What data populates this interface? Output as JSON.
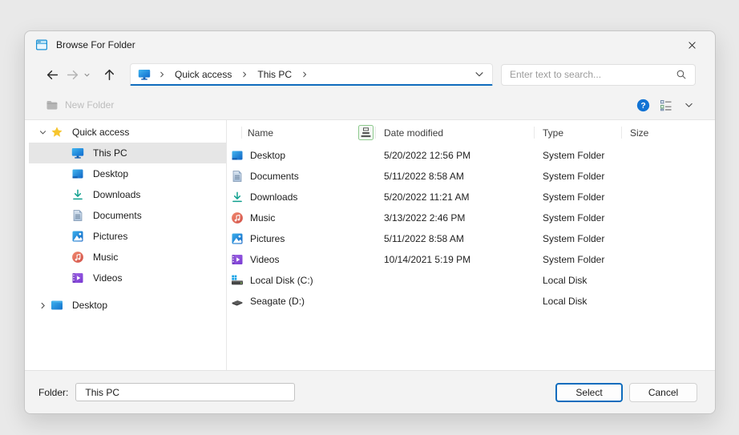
{
  "window": {
    "title": "Browse For Folder",
    "icon": "app-window-icon",
    "close_icon": "close-icon"
  },
  "navigation": {
    "back_icon": "back-arrow-icon",
    "forward_icon": "forward-arrow-icon",
    "history_caret_icon": "dropdown-caret-icon",
    "up_icon": "up-arrow-icon",
    "breadcrumb": {
      "root_icon": "this-pc-icon",
      "items": [
        "Quick access",
        "This PC"
      ]
    },
    "address_dropdown_icon": "chevron-down-icon",
    "search": {
      "placeholder": "Enter text to search...",
      "icon": "search-icon"
    }
  },
  "toolbar": {
    "new_folder_label": "New Folder",
    "new_folder_icon": "new-folder-icon",
    "new_folder_enabled": false,
    "help_icon": "help-icon",
    "view_options_icon": "details-view-icon",
    "more_icon": "chevron-down-icon"
  },
  "sidebar": {
    "items": [
      {
        "label": "Quick access",
        "icon": "star-icon",
        "level": 0,
        "expander": "down",
        "selected": false
      },
      {
        "label": "This PC",
        "icon": "this-pc-icon",
        "level": 1,
        "expander": null,
        "selected": true
      },
      {
        "label": "Desktop",
        "icon": "desktop-icon",
        "level": 1,
        "expander": null,
        "selected": false
      },
      {
        "label": "Downloads",
        "icon": "downloads-icon",
        "level": 1,
        "expander": null,
        "selected": false
      },
      {
        "label": "Documents",
        "icon": "documents-icon",
        "level": 1,
        "expander": null,
        "selected": false
      },
      {
        "label": "Pictures",
        "icon": "pictures-icon",
        "level": 1,
        "expander": null,
        "selected": false
      },
      {
        "label": "Music",
        "icon": "music-icon",
        "level": 1,
        "expander": null,
        "selected": false
      },
      {
        "label": "Videos",
        "icon": "videos-icon",
        "level": 1,
        "expander": null,
        "selected": false
      },
      {
        "label": "Desktop",
        "icon": "desktop-root-icon",
        "level": 0,
        "expander": "right",
        "selected": false,
        "group_gap": true
      }
    ]
  },
  "file_list": {
    "columns": [
      {
        "label": "Name",
        "sort_indicator": true
      },
      {
        "label": "Date modified"
      },
      {
        "label": "Type"
      },
      {
        "label": "Size"
      }
    ],
    "sort_indicator_icon": "sort-indicator-icon",
    "rows": [
      {
        "name": "Desktop",
        "icon": "desktop-icon",
        "date_modified": "5/20/2022 12:56 PM",
        "type": "System Folder",
        "size": ""
      },
      {
        "name": "Documents",
        "icon": "documents-icon",
        "date_modified": "5/11/2022 8:58 AM",
        "type": "System Folder",
        "size": ""
      },
      {
        "name": "Downloads",
        "icon": "downloads-icon",
        "date_modified": "5/20/2022 11:21 AM",
        "type": "System Folder",
        "size": ""
      },
      {
        "name": "Music",
        "icon": "music-icon",
        "date_modified": "3/13/2022 2:46 PM",
        "type": "System Folder",
        "size": ""
      },
      {
        "name": "Pictures",
        "icon": "pictures-icon",
        "date_modified": "5/11/2022 8:58 AM",
        "type": "System Folder",
        "size": ""
      },
      {
        "name": "Videos",
        "icon": "videos-icon",
        "date_modified": "10/14/2021 5:19 PM",
        "type": "System Folder",
        "size": ""
      },
      {
        "name": "Local Disk (C:)",
        "icon": "local-disk-icon",
        "date_modified": "",
        "type": "Local Disk",
        "size": ""
      },
      {
        "name": "Seagate (D:)",
        "icon": "external-drive-icon",
        "date_modified": "",
        "type": "Local Disk",
        "size": ""
      }
    ]
  },
  "footer": {
    "folder_label": "Folder:",
    "folder_value": "This PC",
    "select_label": "Select",
    "cancel_label": "Cancel"
  },
  "colors": {
    "accent_blue": "#0f6cbd",
    "help_blue": "#1173d4",
    "star_gold": "#f6c52e",
    "downloads_teal": "#10a08f",
    "disabled_text": "#bdbdbd",
    "selection_gray": "#e6e6e6",
    "dialog_chrome": "#f3f3f3"
  }
}
